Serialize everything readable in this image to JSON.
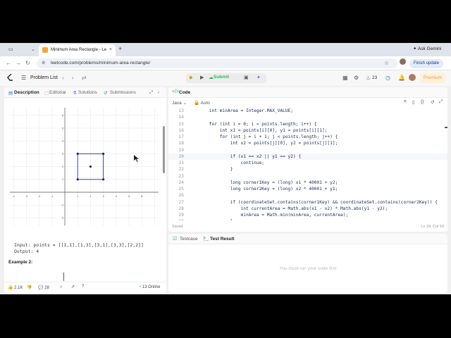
{
  "browser": {
    "tab_title": "Minimum Area Rectangle - Le",
    "new_tab": "+",
    "url": "leetcode.com/problems/minimum-area-rectangle/",
    "ask_gemini": "Ask Gemini",
    "finish_update": "Finish update"
  },
  "topbar": {
    "problem_list": "Problem List",
    "submit": "Submit",
    "streak": "23",
    "premium": "Premium"
  },
  "left_tabs": [
    "Description",
    "Editorial",
    "Solutions",
    "Submissions"
  ],
  "example": {
    "input_line": "Input: points = [[1,1],[1,3],[3,1],[3,3],[2,2]]",
    "output_line": "Output: 4",
    "example2": "Example 2:"
  },
  "plot_data": {
    "x_ticks": [
      "-4",
      "-3",
      "-2",
      "-1",
      "1",
      "2",
      "3",
      "4",
      "5",
      "6"
    ],
    "y_ticks": [
      "6",
      "5",
      "4",
      "3",
      "2",
      "1",
      "-1",
      "-2"
    ],
    "points": [
      [
        1,
        1
      ],
      [
        1,
        3
      ],
      [
        3,
        1
      ],
      [
        3,
        3
      ],
      [
        2,
        2
      ]
    ]
  },
  "footer": {
    "likes": "2.1K",
    "comments": "28",
    "online": "13 Online"
  },
  "editor": {
    "tab": "Code",
    "lang": "Java",
    "mode": "Auto",
    "saved": "Saved",
    "position": "Ln 18, Col 59"
  },
  "code_lines": [
    {
      "n": "13",
      "t": "        int minArea = Integer.MAX_VALUE;"
    },
    {
      "n": "14",
      "t": ""
    },
    {
      "n": "15",
      "t": "        for (int i = 0; i < points.length; i++) {"
    },
    {
      "n": "16",
      "t": "            int x1 = points[i][0], y1 = points[i][1];"
    },
    {
      "n": "17",
      "t": "            for (int j = i + 1; j < points.length; j++) {"
    },
    {
      "n": "18",
      "t": "                int x2 = points[j][0], y2 = points[j][1];"
    },
    {
      "n": "19",
      "t": ""
    },
    {
      "n": "20",
      "t": "                if (x1 == x2 || y1 == y2) {"
    },
    {
      "n": "21",
      "t": "                    continue;"
    },
    {
      "n": "22",
      "t": "                }"
    },
    {
      "n": "23",
      "t": ""
    },
    {
      "n": "24",
      "t": "                long corner1Key = (long) x1 * 40001 + y2;"
    },
    {
      "n": "25",
      "t": "                long corner2Key = (long) x2 * 40001 + y1;"
    },
    {
      "n": "26",
      "t": ""
    },
    {
      "n": "27",
      "t": "                if (coordinateSet.contains(corner1Key) && coordinateSet.contains(corner2Key)) {"
    },
    {
      "n": "28",
      "t": "                    int currentArea = Math.abs(x1 - x2) * Math.abs(y1 - y2);"
    },
    {
      "n": "29",
      "t": "                    minArea = Math.min(minArea, currentArea);"
    },
    {
      "n": "30",
      "t": "                }"
    }
  ],
  "bottom": {
    "testcase": "Testcase",
    "test_result": "Test Result",
    "message": "You must run your code first"
  }
}
